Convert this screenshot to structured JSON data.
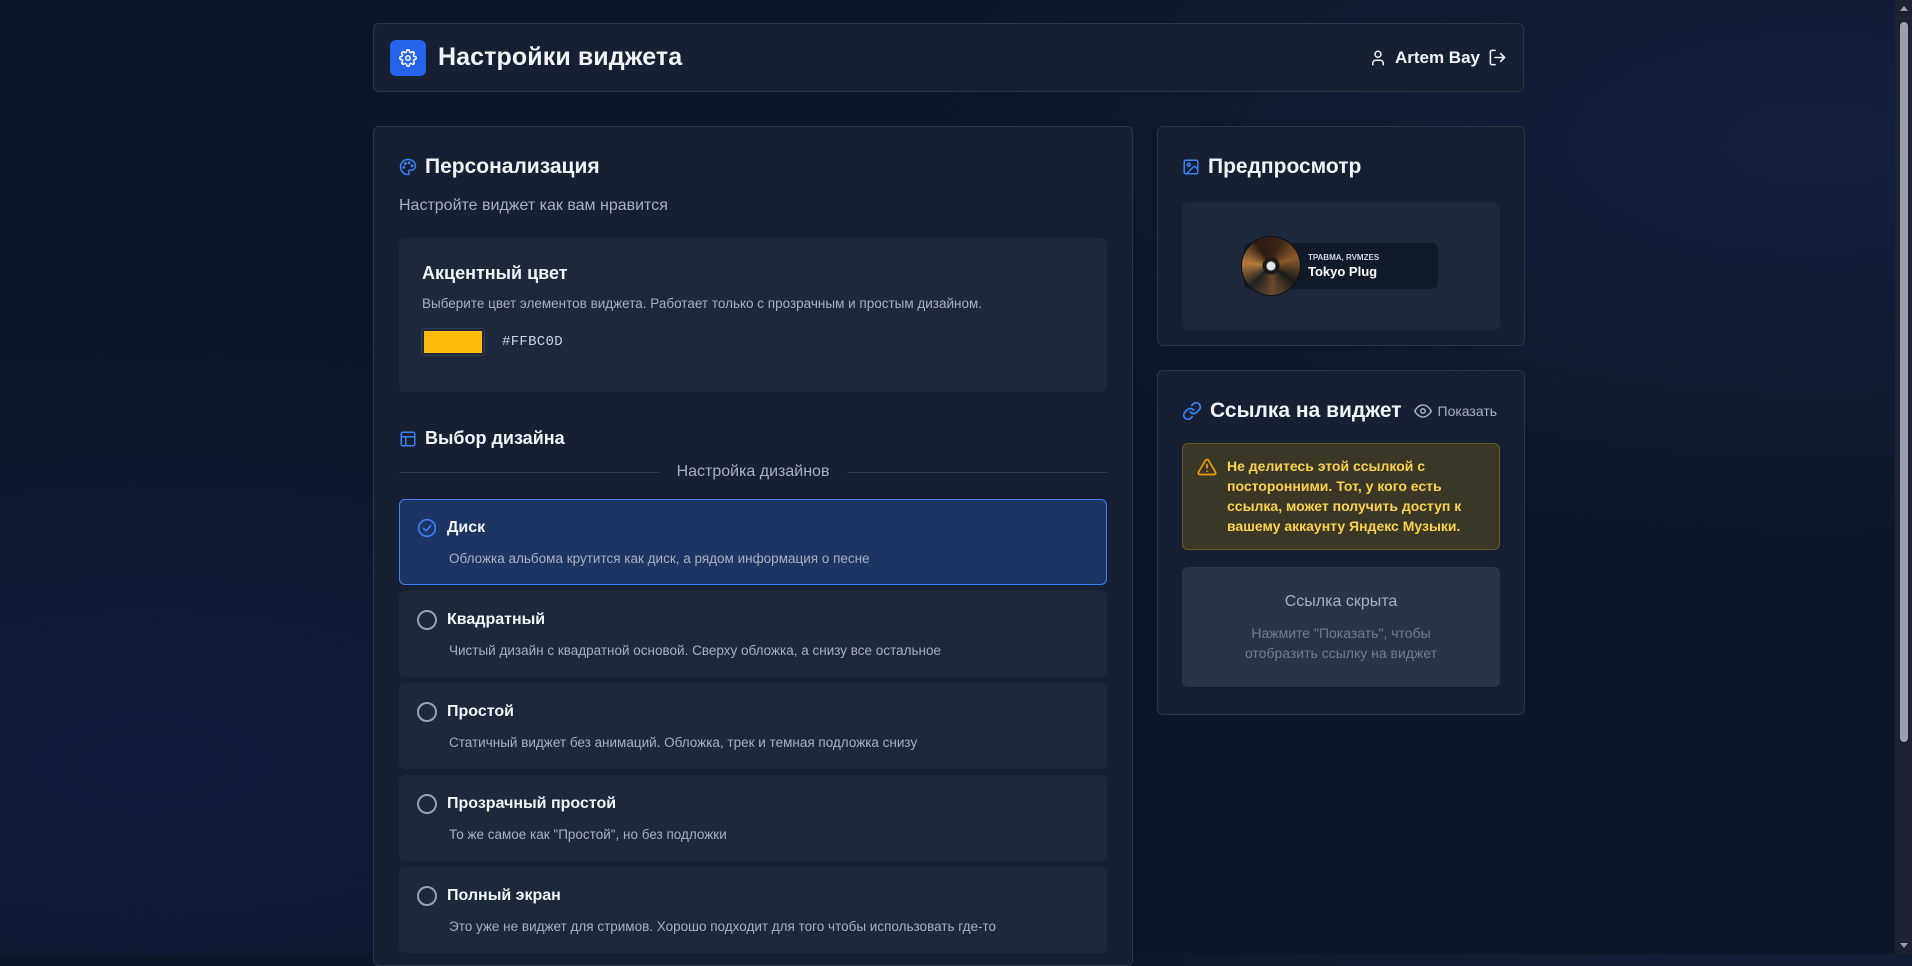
{
  "header": {
    "title": "Настройки виджета",
    "user_name": "Artem Bay"
  },
  "personalization": {
    "title": "Персонализация",
    "subtitle": "Настройте виджет как вам нравится",
    "accent": {
      "title": "Акцентный цвет",
      "description": "Выберите цвет элементов виджета. Работает только с прозрачным и простым дизайном.",
      "color": "#FFBC0D",
      "hex_label": "#FFBC0D"
    }
  },
  "design": {
    "title": "Выбор дизайна",
    "divider_label": "Настройка дизайнов",
    "options": [
      {
        "name": "Диск",
        "description": "Обложка альбома крутится как диск, а рядом информация о песне",
        "selected": true
      },
      {
        "name": "Квадратный",
        "description": "Чистый дизайн с квадратной основой. Сверху обложка, а снизу все остальное",
        "selected": false
      },
      {
        "name": "Простой",
        "description": "Статичный виджет без анимаций. Обложка, трек и темная подложка снизу",
        "selected": false
      },
      {
        "name": "Прозрачный простой",
        "description": "То же самое как \"Простой\", но без подложки",
        "selected": false
      },
      {
        "name": "Полный экран",
        "description": "Это уже не виджет для стримов. Хорошо подходит для того чтобы использовать где-то",
        "selected": false
      }
    ]
  },
  "preview": {
    "title": "Предпросмотр",
    "widget": {
      "artist": "ТРАВМА, RVMZES",
      "track": "Tokyo Plug"
    }
  },
  "widget_link": {
    "title": "Ссылка на виджет",
    "show_label": "Показать",
    "warning": "Не делитесь этой ссылкой с посторонними. Тот, у кого есть ссылка, может получить доступ к вашему аккаунту Яндекс Музыки.",
    "hidden_title": "Ссылка скрыта",
    "hidden_desc_line1": "Нажмите \"Показать\", чтобы",
    "hidden_desc_line2": "отобразить ссылку на виджет"
  },
  "colors": {
    "primary": "#2563eb",
    "accent_selected": "#3b82f6",
    "warning_text": "#fcd34d",
    "background": "#0d1628",
    "card": "#172033"
  }
}
